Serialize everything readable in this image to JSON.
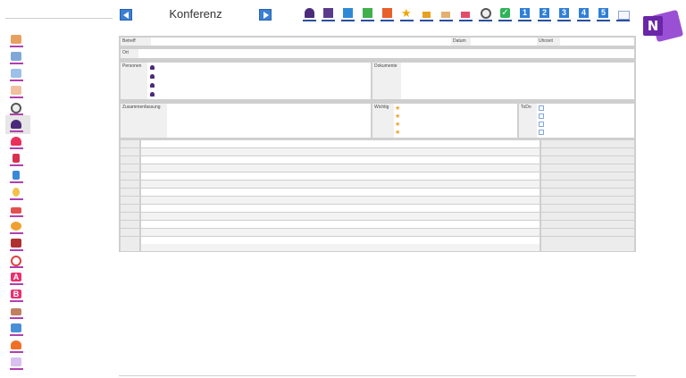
{
  "header": {
    "title": "Konferenz",
    "prev_icon": "arrow-left-icon",
    "next_icon": "arrow-right-icon",
    "toolbar": [
      {
        "icon": "person-icon",
        "name": "person"
      },
      {
        "icon": "book-purple-icon",
        "name": "book-purple"
      },
      {
        "icon": "book-blue-icon",
        "name": "book-blue"
      },
      {
        "icon": "book-green-icon",
        "name": "book-green"
      },
      {
        "icon": "book-orange-icon",
        "name": "book-orange"
      },
      {
        "icon": "star-icon",
        "name": "star"
      },
      {
        "icon": "lock-icon",
        "name": "lock"
      },
      {
        "icon": "house-icon",
        "name": "house"
      },
      {
        "icon": "house-red-icon",
        "name": "house-red"
      },
      {
        "icon": "clock-icon",
        "name": "clock"
      },
      {
        "icon": "check-icon",
        "name": "check"
      },
      {
        "icon": "number-1-icon",
        "name": "num1",
        "label": "1"
      },
      {
        "icon": "number-2-icon",
        "name": "num2",
        "label": "2"
      },
      {
        "icon": "number-3-icon",
        "name": "num3",
        "label": "3"
      },
      {
        "icon": "number-4-icon",
        "name": "num4",
        "label": "4"
      },
      {
        "icon": "number-5-icon",
        "name": "num5",
        "label": "5"
      },
      {
        "icon": "open-book-icon",
        "name": "open-book"
      }
    ]
  },
  "logo": {
    "letter": "N",
    "icon": "onenote-logo-icon"
  },
  "sidebar": {
    "items": [
      "home-icon",
      "building-icon",
      "building2-icon",
      "pen-icon",
      "clock-icon",
      "person-icon",
      "heart-icon",
      "pin-icon",
      "pin-blue-icon",
      "bulb-icon",
      "car-icon",
      "coin-icon",
      "bag-icon",
      "target-icon",
      "letter-a-icon",
      "letter-b-icon",
      "mountain-icon",
      "image-icon",
      "fire-icon",
      "book-icon"
    ],
    "letter_a": "A",
    "letter_b": "B"
  },
  "form": {
    "betreff_label": "Betreff",
    "datum_label": "Datum",
    "uhrzeit_label": "Uhrzeit",
    "ort_label": "Ort",
    "personen_label": "Personen",
    "dokumente_label": "Dokumente",
    "zusammenfassung_label": "Zusammenfassung",
    "wichtig_label": "Wichtig",
    "todo_label": "ToDo",
    "person_count": 4,
    "star_count": 4,
    "todo_count": 4
  },
  "colors": {
    "accent_blue": "#2f7fd6",
    "person_purple": "#4b2a7a",
    "star_orange": "#f0a020",
    "onenote_purple": "#6a25a8"
  }
}
